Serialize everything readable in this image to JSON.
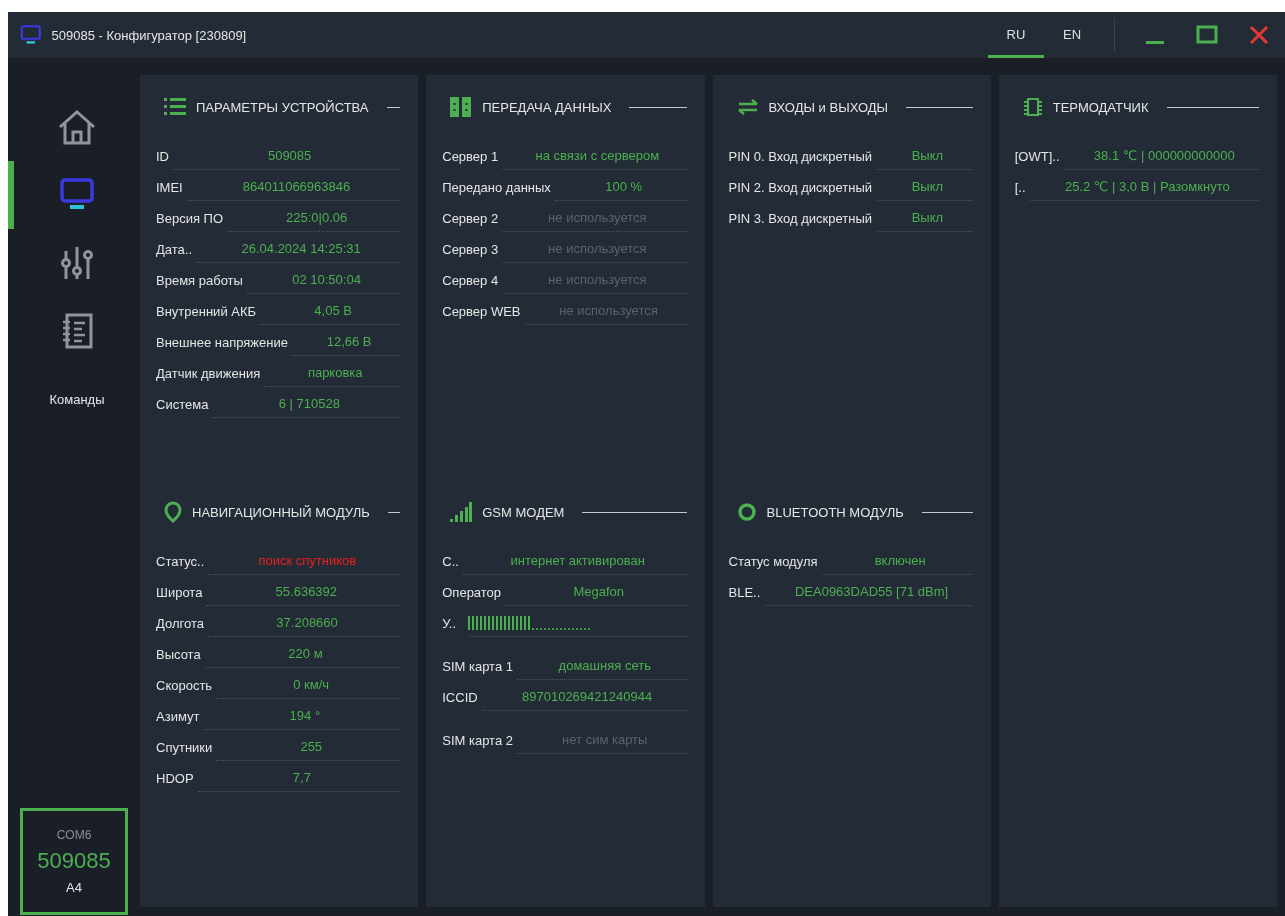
{
  "window": {
    "title": "509085 - Конфигуратор [230809]"
  },
  "languages": [
    {
      "label": "RU",
      "selected": true
    },
    {
      "label": "EN",
      "selected": false
    }
  ],
  "sidebar": {
    "items": [
      {
        "kind": "home",
        "selected": false
      },
      {
        "kind": "device",
        "selected": true
      },
      {
        "kind": "settings",
        "selected": false
      },
      {
        "kind": "log",
        "selected": false
      },
      {
        "kind": "text",
        "label": "Команды",
        "selected": false
      }
    ],
    "connection": {
      "port": "COM6",
      "id": "509085",
      "model": "A4"
    }
  },
  "columns": [
    {
      "sections": [
        {
          "title": "ПАРАМЕТРЫ УСТРОЙСТВА",
          "rows": [
            {
              "label": "ID",
              "value": "509085",
              "color": "#4caf50"
            },
            {
              "label": "IMEI",
              "value": "864011066963846",
              "color": "#4caf50"
            },
            {
              "label": "Версия ПО",
              "value": "225:0|0.06",
              "color": "#4caf50"
            },
            {
              "label": "Дата..",
              "value": "26.04.2024 14:25:31",
              "color": "#4caf50"
            },
            {
              "label": "Время работы",
              "value": "02 10:50:04",
              "color": "#4caf50"
            },
            {
              "label": "Внутренний АКБ",
              "value": "4,05 В",
              "color": "#4caf50"
            },
            {
              "label": "Внешнее напряжение",
              "value": "12,66 В",
              "color": "#4caf50"
            },
            {
              "label": "Датчик движения",
              "value": "парковка",
              "color": "#4caf50"
            },
            {
              "label": "Система",
              "value": "6 | 710528",
              "color": "#4caf50"
            }
          ]
        },
        {
          "title": "НАВИГАЦИОННЫЙ МОДУЛЬ",
          "rows": [
            {
              "label": "Статус..",
              "value": "поиск спутников",
              "color": "#e8221b"
            },
            {
              "label": "Широта",
              "value": "55.636392",
              "color": "#4caf50"
            },
            {
              "label": "Долгота",
              "value": "37.208660",
              "color": "#4caf50"
            },
            {
              "label": "Высота",
              "value": "220 м",
              "color": "#4caf50"
            },
            {
              "label": "Скорость",
              "value": "0 км/ч",
              "color": "#4caf50"
            },
            {
              "label": "Азимут",
              "value": "194 °",
              "color": "#4caf50"
            },
            {
              "label": "Спутники",
              "value": "255",
              "color": "#4caf50"
            },
            {
              "label": "HDOP",
              "value": "7,7",
              "color": "#4caf50"
            }
          ]
        }
      ]
    },
    {
      "sections": [
        {
          "title": "ПЕРЕДАЧА ДАННЫХ",
          "rows": [
            {
              "label": "Сервер 1",
              "value": "на связи с сервером",
              "color": "#4caf50"
            },
            {
              "label": "Передано данных",
              "value": "100 %",
              "color": "#4caf50"
            },
            {
              "label": "Сервер 2",
              "value": "не используется",
              "color": "#5b636d"
            },
            {
              "label": "Сервер 3",
              "value": "не используется",
              "color": "#5b636d"
            },
            {
              "label": "Сервер 4",
              "value": "не используется",
              "color": "#5b636d"
            },
            {
              "label": "Сервер WEB",
              "value": "не используется",
              "color": "#5b636d"
            }
          ]
        },
        {
          "title": "GSM МОДЕМ",
          "rows": [
            {
              "label": "С..",
              "value": "интернет активирован",
              "color": "#4caf50"
            },
            {
              "label": "Оператор",
              "value": "Megafon",
              "color": "#4caf50"
            },
            {
              "label": "У..",
              "kind": "meter",
              "level": 0.52
            },
            {
              "label": "SIM карта 1",
              "value": "домашняя сеть",
              "color": "#4caf50",
              "gap_before": true
            },
            {
              "label": "ICCID",
              "value": "897010269421240944",
              "color": "#4caf50"
            },
            {
              "label": "SIM карта 2",
              "value": "нет сим карты",
              "color": "#5b636d",
              "gap_before": true
            }
          ]
        }
      ]
    },
    {
      "sections": [
        {
          "title": "ВХОДЫ и ВЫХОДЫ",
          "rows": [
            {
              "label": "PIN 0. Вход дискретный",
              "value": "Выкл",
              "color": "#4caf50"
            },
            {
              "label": "PIN 2. Вход дискретный",
              "value": "Выкл",
              "color": "#4caf50"
            },
            {
              "label": "PIN 3. Вход дискретный",
              "value": "Выкл",
              "color": "#4caf50"
            }
          ]
        },
        {
          "title": "BLUETOOTH МОДУЛЬ",
          "rows": [
            {
              "label": "Статус модуля",
              "value": "включен",
              "color": "#4caf50"
            },
            {
              "label": "BLE..",
              "value": "DEA0963DAD55 [71 dBm]",
              "color": "#4caf50"
            }
          ]
        }
      ]
    },
    {
      "sections": [
        {
          "title": "ТЕРМОДАТЧИК",
          "rows": [
            {
              "label": "[OWT]..",
              "value": "38.1 ℃ | 000000000000",
              "color": "#4caf50"
            },
            {
              "label": "[..",
              "value": "25.2 ℃ | 3,0 В | Разомкнуто",
              "color": "#4caf50"
            }
          ]
        }
      ]
    }
  ]
}
